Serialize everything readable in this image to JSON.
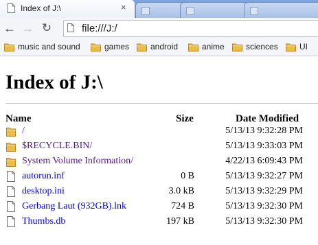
{
  "browser": {
    "active_tab": {
      "title": "Index of J:\\",
      "close_glyph": "×",
      "favicon": "page-icon"
    },
    "background_tabs": [
      {
        "title": ""
      },
      {
        "title": ""
      },
      {
        "title": ""
      }
    ],
    "toolbar": {
      "back_glyph": "←",
      "forward_glyph": "→",
      "reload_glyph": "↻",
      "url": "file:///J:/"
    },
    "bookmarks": [
      {
        "label": "music and sound",
        "icon": "folder-icon"
      },
      {
        "label": "games",
        "icon": "folder-icon"
      },
      {
        "label": "android",
        "icon": "folder-icon"
      },
      {
        "label": "anime",
        "icon": "folder-icon"
      },
      {
        "label": "sciences",
        "icon": "folder-icon"
      },
      {
        "label": "UI",
        "icon": "folder-icon"
      }
    ]
  },
  "page": {
    "title": "Index of J:\\",
    "columns": {
      "name": "Name",
      "size": "Size",
      "date": "Date Modified"
    },
    "rows": [
      {
        "icon": "folder-icon",
        "name": " /",
        "size": "",
        "date": "5/13/13 9:32:28 PM",
        "visited": true
      },
      {
        "icon": "folder-icon",
        "name": "$RECYCLE.BIN/",
        "size": "",
        "date": "5/13/13 9:33:03 PM",
        "visited": true
      },
      {
        "icon": "folder-icon",
        "name": "System Volume Information/",
        "size": "",
        "date": "4/22/13 6:09:43 PM",
        "visited": true
      },
      {
        "icon": "file-icon",
        "name": "autorun.inf",
        "size": "0 B",
        "date": "5/13/13 9:32:27 PM",
        "visited": false
      },
      {
        "icon": "file-icon",
        "name": "desktop.ini",
        "size": "3.0 kB",
        "date": "5/13/13 9:32:29 PM",
        "visited": false
      },
      {
        "icon": "file-icon",
        "name": "Gerbang Laut (932GB).lnk",
        "size": "724 B",
        "date": "5/13/13 9:32:30 PM",
        "visited": false
      },
      {
        "icon": "file-icon",
        "name": "Thumbs.db",
        "size": "197 kB",
        "date": "5/13/13 9:32:30 PM",
        "visited": false
      }
    ]
  },
  "colors": {
    "link": "#0000ee",
    "visited_link": "#551a8b",
    "folder": "#e8bd4c",
    "tabstrip": "#6f97d1"
  }
}
